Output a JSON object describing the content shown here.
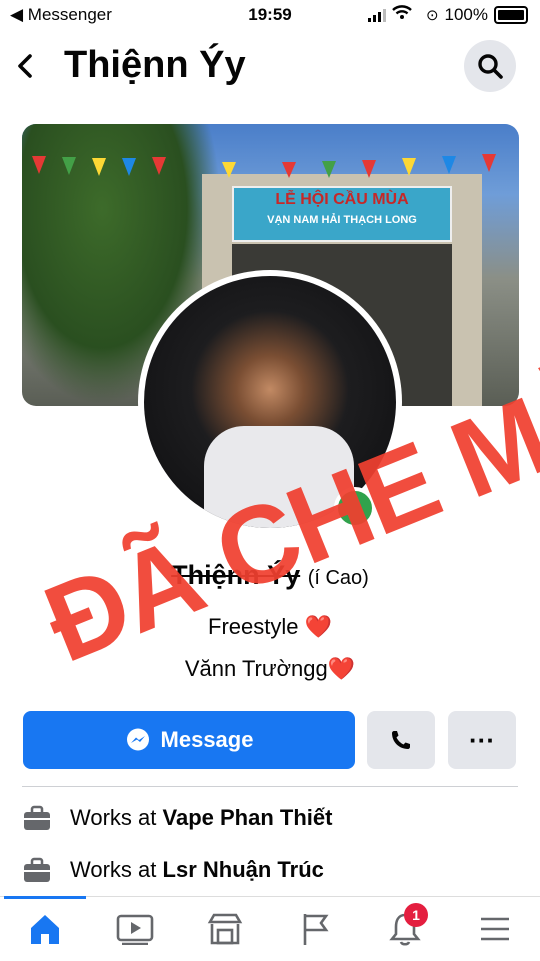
{
  "status_bar": {
    "back_app": "◀ Messenger",
    "time": "19:59",
    "battery": "100%"
  },
  "header": {
    "back_glyph": "<",
    "title": "Thiệnn Ýy",
    "search_icon": "search-icon"
  },
  "cover": {
    "banner_line1": "LỄ HỘI CẦU MÙA",
    "banner_line2": "VẠN NAM HẢI THẠCH LONG"
  },
  "profile": {
    "name": "Thiệnn Ýy",
    "alt_name": "(í Cao)",
    "bio_line1": "Freestyle ❤️",
    "bio_line2": "Vănn Trườngg❤️",
    "online": true,
    "overlay_text": "ĐÃ CHE MẶT"
  },
  "actions": {
    "message_label": "Message",
    "more_label": "···"
  },
  "works": [
    {
      "prefix": "Works at",
      "place": "Vape Phan Thiết"
    },
    {
      "prefix": "Works at",
      "place": "Lsr Nhuận Trúc"
    }
  ],
  "tabbar": {
    "notification_count": "1",
    "active_color": "#1877f2"
  },
  "colors": {
    "accent": "#1877f2",
    "online": "#31a24c",
    "badge": "#e41e3f",
    "overlay": "#f04030"
  }
}
